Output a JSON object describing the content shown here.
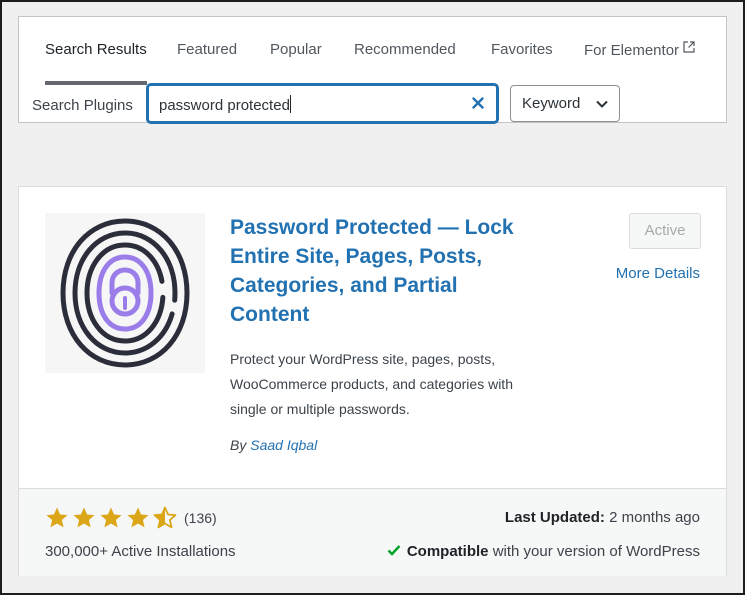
{
  "tabs": [
    {
      "label": "Search Results"
    },
    {
      "label": "Featured"
    },
    {
      "label": "Popular"
    },
    {
      "label": "Recommended"
    },
    {
      "label": "Favorites"
    },
    {
      "label": "For Elementor"
    }
  ],
  "search": {
    "label": "Search Plugins",
    "value": "password protected",
    "type_value": "Keyword"
  },
  "plugin": {
    "title": "Password Protected — Lock Entire Site, Pages, Posts, Categories, and Partial Content",
    "description": "Protect your WordPress site, pages, posts, WooCommerce products, and categories with single or multiple passwords.",
    "author_prefix": "By",
    "author": "Saad Iqbal",
    "action_label": "Active",
    "more_details": "More Details",
    "rating": 4.5,
    "rating_count": "(136)",
    "installs": "300,000+ Active Installations",
    "last_updated_label": "Last Updated:",
    "last_updated_value": "2 months ago",
    "compat_strong": "Compatible",
    "compat_rest": "with your version of WordPress"
  },
  "colors": {
    "accent": "#2271b1",
    "star": "#dba617",
    "check": "#00a32a",
    "icon_dark": "#2b2e3a",
    "icon_purple": "#9b7dea"
  }
}
